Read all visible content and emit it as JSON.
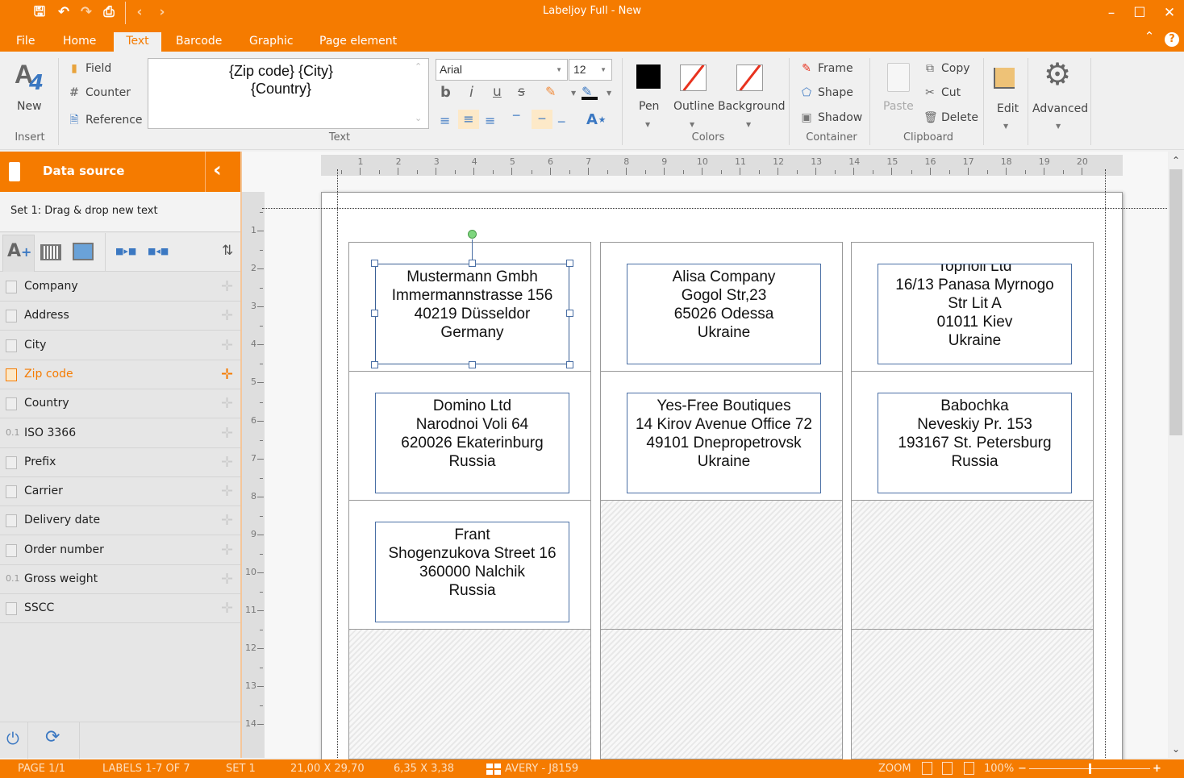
{
  "window": {
    "title": "Labeljoy Full - New",
    "accent": "#f57b00"
  },
  "quick_access": [
    "save-icon",
    "undo-icon",
    "redo-icon",
    "print-icon",
    "back-icon",
    "forward-icon"
  ],
  "menu": {
    "items": [
      "File",
      "Home",
      "Text",
      "Barcode",
      "Graphic",
      "Page element"
    ],
    "active": "Text"
  },
  "ribbon": {
    "insert": {
      "new_label": "New",
      "group_label": "Insert"
    },
    "text_items": {
      "field": "Field",
      "counter": "Counter",
      "reference": "Reference"
    },
    "text_editor": {
      "line1": "{Zip code} {City}",
      "line2": "{Country}",
      "group_label": "Text"
    },
    "font": {
      "family": "Arial",
      "size": "12"
    },
    "format_buttons": {
      "bold": "b",
      "italic": "i",
      "underline": "u",
      "strike": "s"
    },
    "colors": {
      "pen": "Pen",
      "outline": "Outline",
      "background": "Background",
      "group_label": "Colors",
      "pen_color": "#000000",
      "none_color": "#e8321e"
    },
    "container": {
      "frame": "Frame",
      "shape": "Shape",
      "shadow": "Shadow",
      "group_label": "Container"
    },
    "clipboard": {
      "paste": "Paste",
      "copy": "Copy",
      "cut": "Cut",
      "delete": "Delete",
      "group_label": "Clipboard"
    },
    "edit": {
      "label": "Edit"
    },
    "advanced": {
      "label": "Advanced"
    }
  },
  "sidebar": {
    "title": "Data source",
    "subtitle": "Set 1: Drag & drop new text",
    "fields": [
      {
        "label": "Company",
        "type": "text"
      },
      {
        "label": "Address",
        "type": "text"
      },
      {
        "label": "City",
        "type": "text"
      },
      {
        "label": "Zip code",
        "type": "text",
        "active": true
      },
      {
        "label": "Country",
        "type": "text"
      },
      {
        "label": "ISO 3366",
        "type": "number"
      },
      {
        "label": "Prefix",
        "type": "text"
      },
      {
        "label": "Carrier",
        "type": "text"
      },
      {
        "label": "Delivery date",
        "type": "date"
      },
      {
        "label": "Order number",
        "type": "text"
      },
      {
        "label": "Gross weight",
        "type": "number"
      },
      {
        "label": "SSCC",
        "type": "text"
      }
    ],
    "number_badge": "0.1"
  },
  "rulers": {
    "horizontal": [
      "1",
      "2",
      "3",
      "4",
      "5",
      "6",
      "7",
      "8",
      "9",
      "10",
      "11",
      "12",
      "13",
      "14",
      "15",
      "16",
      "17",
      "18",
      "19",
      "20"
    ],
    "vertical": [
      "1",
      "2",
      "3",
      "4",
      "5",
      "6",
      "7",
      "8",
      "9",
      "10",
      "11",
      "12",
      "13",
      "14"
    ]
  },
  "labels": [
    {
      "lines": [
        "Mustermann Gmbh",
        "Immermannstrasse 156",
        "40219 Düsseldor",
        "Germany"
      ],
      "selected": true
    },
    {
      "lines": [
        "Alisa Company",
        "Gogol Str,23",
        "65026 Odessa",
        "Ukraine"
      ]
    },
    {
      "lines": [
        "Tophoil Ltd",
        "16/13 Panasa Myrnogo",
        "Str Lit A",
        "01011 Kiev",
        "Ukraine"
      ]
    },
    {
      "lines": [
        "Domino Ltd",
        "Narodnoi Voli 64",
        "620026 Ekaterinburg",
        "Russia"
      ]
    },
    {
      "lines": [
        "Yes-Free Boutiques",
        "14 Kirov Avenue Office 72",
        "49101 Dnepropetrovsk",
        "Ukraine"
      ]
    },
    {
      "lines": [
        "Babochka",
        "Neveskiy  Pr. 153",
        "193167 St. Petersburg",
        "Russia"
      ]
    },
    {
      "lines": [
        "Frant",
        "Shogenzukova Street 16",
        "360000 Nalchik",
        "Russia"
      ]
    }
  ],
  "status": {
    "page": "PAGE 1/1",
    "labels": "LABELS 1-7 OF 7",
    "set": "SET 1",
    "page_size": "21,00 X 29,70",
    "label_size": "6,35 X 3,38",
    "template": "AVERY - J8159",
    "zoom_label": "ZOOM",
    "zoom_value": "100%",
    "zoom_minus": "−",
    "zoom_plus": "+"
  }
}
